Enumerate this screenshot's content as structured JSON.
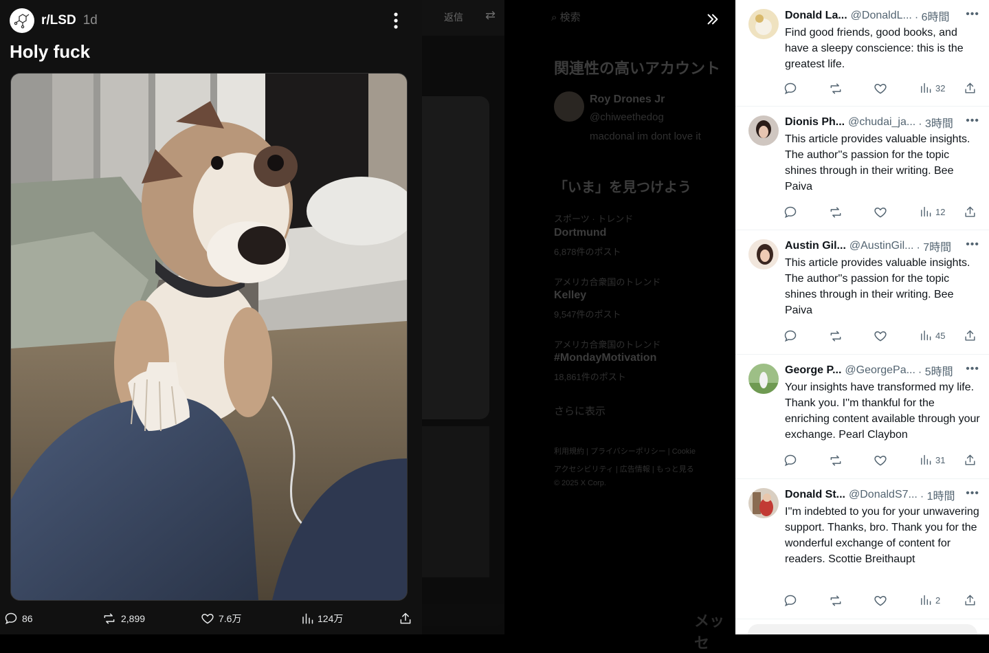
{
  "background": {
    "topbar": {
      "send_label": "返信"
    },
    "search_placeholder": "検索",
    "related_heading": "関連性の高いアカウント",
    "related_account": {
      "name": "Roy Drones Jr",
      "handle": "@chiweethedog",
      "bio": "macdonal im dont love it"
    },
    "trends_heading": "「いま」を見つけよう",
    "trends": [
      {
        "category": "スポーツ · トレンド",
        "name": "Dortmund",
        "posts": "6,878件のポスト"
      },
      {
        "category": "アメリカ合衆国のトレンド",
        "name": "Kelley",
        "posts": "9,547件のポスト"
      },
      {
        "category": "アメリカ合衆国のトレンド",
        "name": "#MondayMotivation",
        "posts": "18,861件のポスト"
      }
    ],
    "show_more": "さらに表示",
    "footer_line1": "利用規約 | プライバシーポリシー | Cookie",
    "footer_line2": "アクセシビリティ | 広告情報 | もっと見る",
    "copyright": "© 2025 X Corp.",
    "messages_label": "メッセ"
  },
  "post": {
    "subreddit": "r/LSD",
    "age": "1d",
    "title": "Holy fuck",
    "actions": {
      "replies": "86",
      "reposts": "2,899",
      "likes": "7.6万",
      "views": "124万"
    }
  },
  "tweets": [
    {
      "name": "Donald La...",
      "handle": "@DonaldL...",
      "time": "· 6時間",
      "text": "Find good friends, good books, and have a sleepy conscience: this is the greatest life.",
      "views": "32",
      "avatar_color": "#e8d3a0"
    },
    {
      "name": "Dionis Ph...",
      "handle": "@chudai_ja...",
      "time": "· 3時間",
      "text": "This article provides valuable insights. The author''s passion for the topic shines through in their writing. Bee Paiva",
      "views": "12",
      "avatar_color": "#6b4a3c"
    },
    {
      "name": "Austin Gil...",
      "handle": "@AustinGil...",
      "time": "· 7時間",
      "text": "This article provides valuable insights. The author''s passion for the topic shines through in their writing. Bee Paiva",
      "views": "45",
      "avatar_color": "#d9b48f"
    },
    {
      "name": "George P...",
      "handle": "@GeorgePa...",
      "time": "· 5時間",
      "text": "Your insights have transformed my life. Thank you. I''m thankful for the enriching content available through your exchange. Pearl Claybon",
      "views": "31",
      "avatar_color": "#7fa36a"
    },
    {
      "name": "Donald St...",
      "handle": "@DonaldS7...",
      "time": "· 1時間",
      "text": "I''m indebted to you for your unwavering support. Thanks, bro. Thank you for the wonderful exchange of content for readers. Scottie Breithaupt",
      "views": "2",
      "avatar_color": "#b8403a"
    }
  ]
}
